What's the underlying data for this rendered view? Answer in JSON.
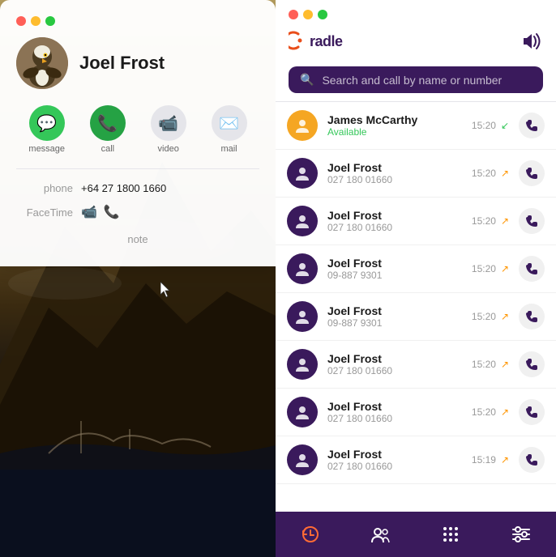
{
  "leftPanel": {
    "windowControls": [
      "close",
      "minimize",
      "maximize"
    ],
    "contact": {
      "name": "Joel Frost",
      "phone": "+64 27 1800 1660",
      "phoneLabel": "phone",
      "facetimeLabel": "FaceTime",
      "noteLabel": "note"
    },
    "actions": [
      {
        "id": "message",
        "label": "message",
        "type": "green"
      },
      {
        "id": "call",
        "label": "call",
        "type": "dark-green"
      },
      {
        "id": "video",
        "label": "video",
        "type": "gray"
      },
      {
        "id": "mail",
        "label": "mail",
        "type": "gray"
      }
    ]
  },
  "rightPanel": {
    "appTitle": "Cradle",
    "windowControls": [
      "close",
      "minimize",
      "maximize"
    ],
    "search": {
      "placeholder": "Search and call by name or number"
    },
    "callList": [
      {
        "id": 1,
        "name": "James McCarthy",
        "sub": "Available",
        "time": "15:20",
        "direction": "incoming",
        "avatarType": "yellow"
      },
      {
        "id": 2,
        "name": "Joel Frost",
        "sub": "027 180 01660",
        "time": "15:20",
        "direction": "outgoing",
        "avatarType": "purple"
      },
      {
        "id": 3,
        "name": "Joel Frost",
        "sub": "027 180 01660",
        "time": "15:20",
        "direction": "outgoing",
        "avatarType": "purple"
      },
      {
        "id": 4,
        "name": "Joel Frost",
        "sub": "09-887 9301",
        "time": "15:20",
        "direction": "outgoing",
        "avatarType": "purple"
      },
      {
        "id": 5,
        "name": "Joel Frost",
        "sub": "09-887 9301",
        "time": "15:20",
        "direction": "outgoing",
        "avatarType": "purple"
      },
      {
        "id": 6,
        "name": "Joel Frost",
        "sub": "027 180 01660",
        "time": "15:20",
        "direction": "outgoing",
        "avatarType": "purple"
      },
      {
        "id": 7,
        "name": "Joel Frost",
        "sub": "027 180 01660",
        "time": "15:20",
        "direction": "outgoing",
        "avatarType": "purple"
      },
      {
        "id": 8,
        "name": "Joel Frost",
        "sub": "027 180 01660",
        "time": "15:19",
        "direction": "outgoing",
        "avatarType": "purple"
      }
    ],
    "bottomNav": [
      {
        "id": "history",
        "icon": "history",
        "active": true
      },
      {
        "id": "contacts",
        "icon": "contacts",
        "active": false
      },
      {
        "id": "dialpad",
        "icon": "dialpad",
        "active": false
      },
      {
        "id": "settings",
        "icon": "settings",
        "active": false
      }
    ]
  }
}
